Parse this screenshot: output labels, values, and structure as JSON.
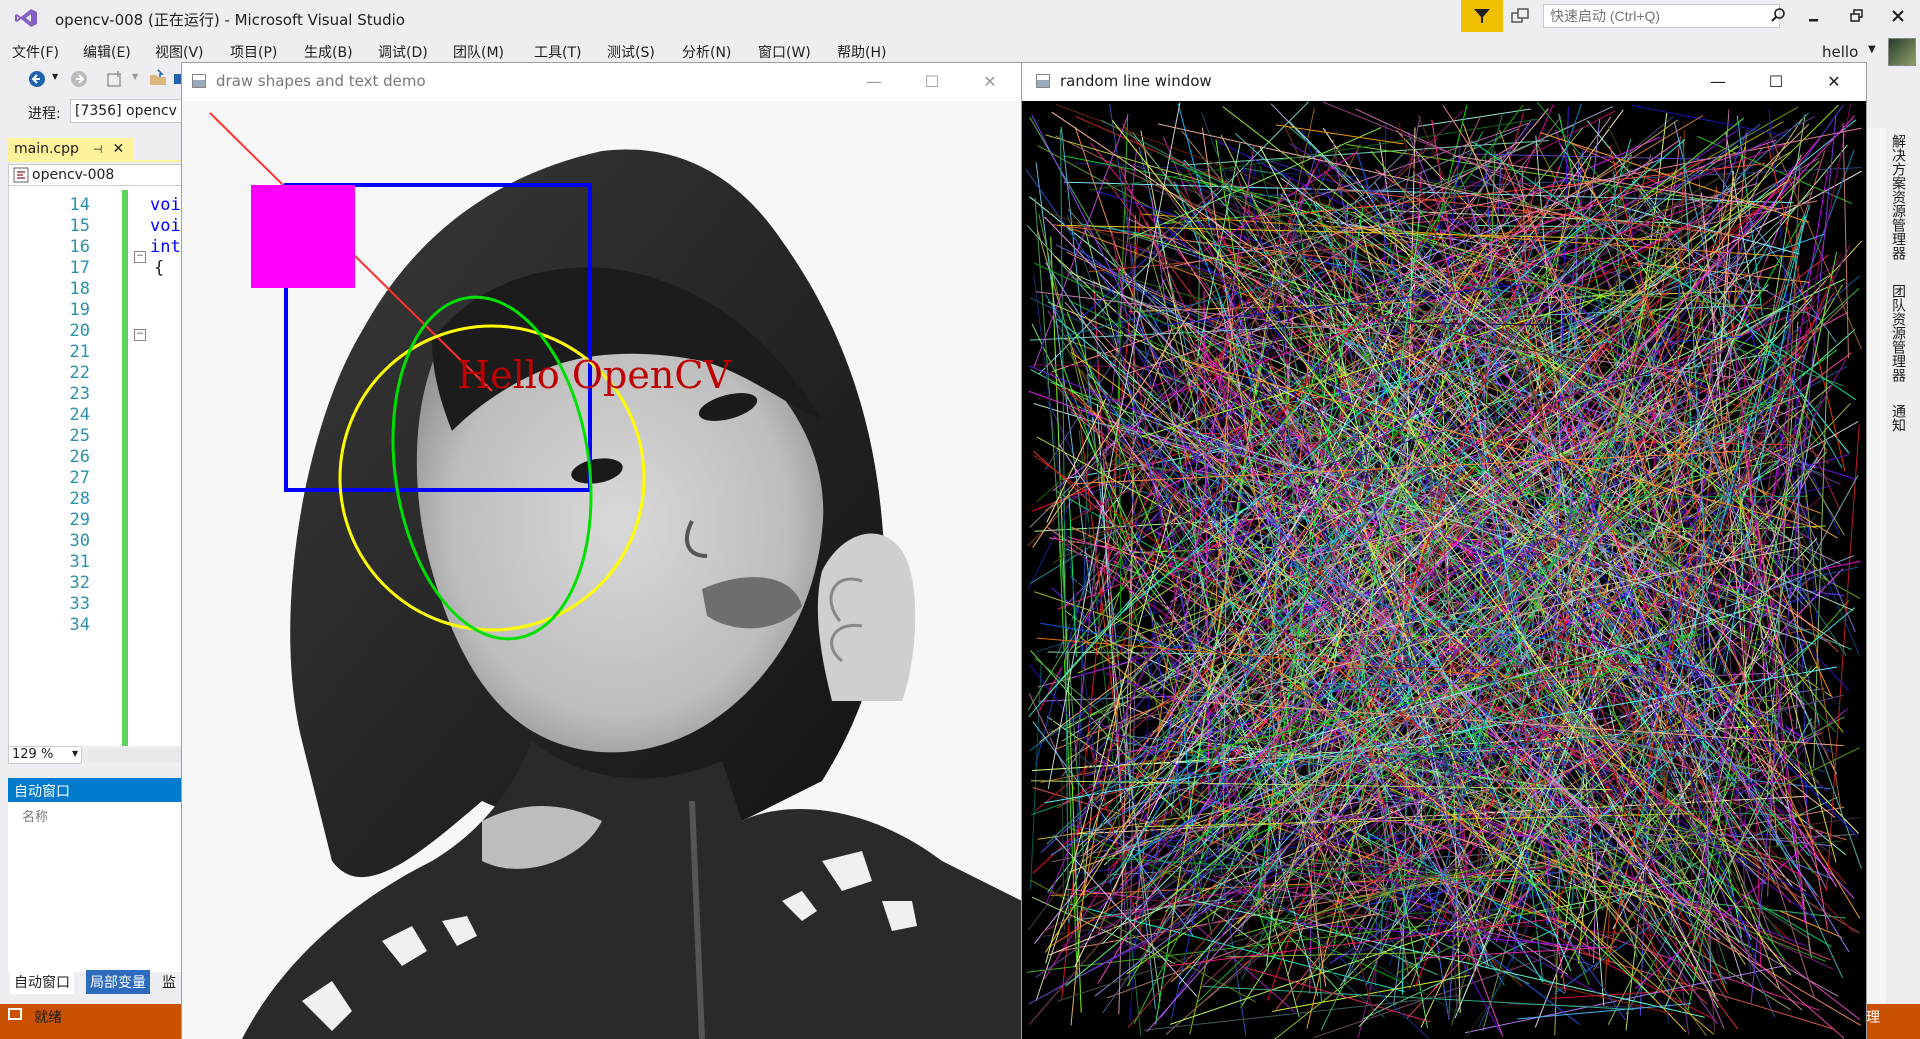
{
  "vs": {
    "title": "opencv-008 (正在运行) - Microsoft Visual Studio",
    "quick_launch_placeholder": "快速启动 (Ctrl+Q)",
    "menu": [
      "文件(F)",
      "编辑(E)",
      "视图(V)",
      "项目(P)",
      "生成(B)",
      "调试(D)",
      "团队(M)",
      "工具(T)",
      "测试(S)",
      "分析(N)",
      "窗口(W)",
      "帮助(H)"
    ],
    "user": "hello",
    "process_label": "进程:",
    "process_value": "[7356] opencv",
    "doc_tab": "main.cpp",
    "doc_tab_pin": "⊣",
    "doc_tab_close": "✕",
    "nav_project": "opencv-008",
    "line_numbers": [
      "14",
      "15",
      "16",
      "17",
      "18",
      "19",
      "20",
      "21",
      "22",
      "23",
      "24",
      "25",
      "26",
      "27",
      "28",
      "29",
      "30",
      "31",
      "32",
      "33",
      "34"
    ],
    "code_fragments": [
      "voi",
      "voi",
      "int",
      "{"
    ],
    "zoom": "129 %",
    "auto_window_title": "自动窗口",
    "auto_col_name": "名称",
    "bottom_tabs": [
      "自动窗口",
      "局部变量",
      "监"
    ],
    "status": "就绪",
    "right_rail": [
      "解决方案资源管理器",
      "团队资源管理器",
      "通知"
    ],
    "right_rail_bottom": "理"
  },
  "win1": {
    "title": "draw shapes and text demo",
    "overlay_text": "Hello OpenCV",
    "colors": {
      "line": "#ff3030",
      "rect_fill": "#ff00ff",
      "rect_outline": "#0000ff",
      "circle": "#ffff00",
      "ellipse": "#00e000",
      "text": "#c00000"
    }
  },
  "win2": {
    "title": "random line window"
  },
  "window_controls": {
    "minimize": "—",
    "maximize": "☐",
    "close": "✕"
  }
}
